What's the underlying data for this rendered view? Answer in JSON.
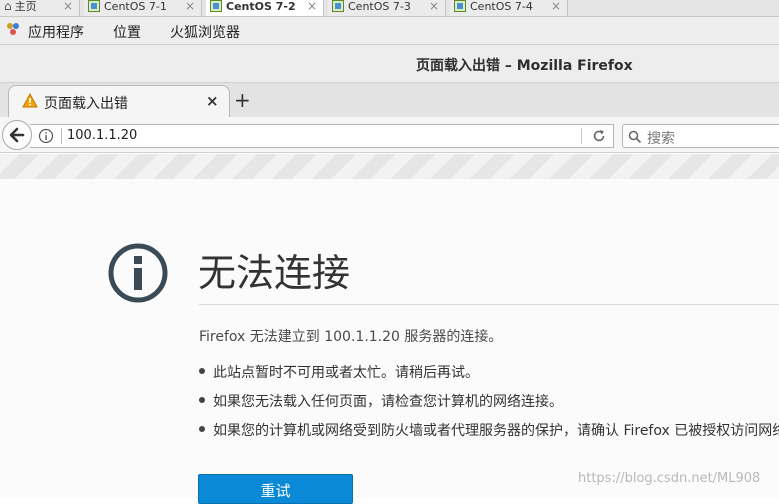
{
  "vm_tabs": [
    {
      "label": "主页",
      "active": false
    },
    {
      "label": "CentOS 7-1",
      "active": false
    },
    {
      "label": "CentOS 7-2",
      "active": true
    },
    {
      "label": "CentOS 7-3",
      "active": false
    },
    {
      "label": "CentOS 7-4",
      "active": false
    }
  ],
  "gnome": {
    "apps": "应用程序",
    "places": "位置",
    "browser": "火狐浏览器"
  },
  "window": {
    "title": "页面载入出错 – Mozilla Firefox"
  },
  "tab": {
    "label": "页面载入出错",
    "icon": "warning-icon"
  },
  "navbar": {
    "url": "100.1.1.20",
    "search_placeholder": "搜索"
  },
  "error": {
    "title": "无法连接",
    "description": "Firefox 无法建立到 100.1.1.20  服务器的连接。",
    "bullets": [
      "此站点暂时不可用或者太忙。请稍后再试。",
      "如果您无法载入任何页面，请检查您计算机的网络连接。",
      "如果您的计算机或网络受到防火墙或者代理服务器的保护，请确认 Firefox 已被授权访问网络。"
    ],
    "retry_label": "重试"
  },
  "watermark": "https://blog.csdn.net/ML908",
  "colors": {
    "accent": "#0a8ad6",
    "warning": "#f0a30a"
  }
}
